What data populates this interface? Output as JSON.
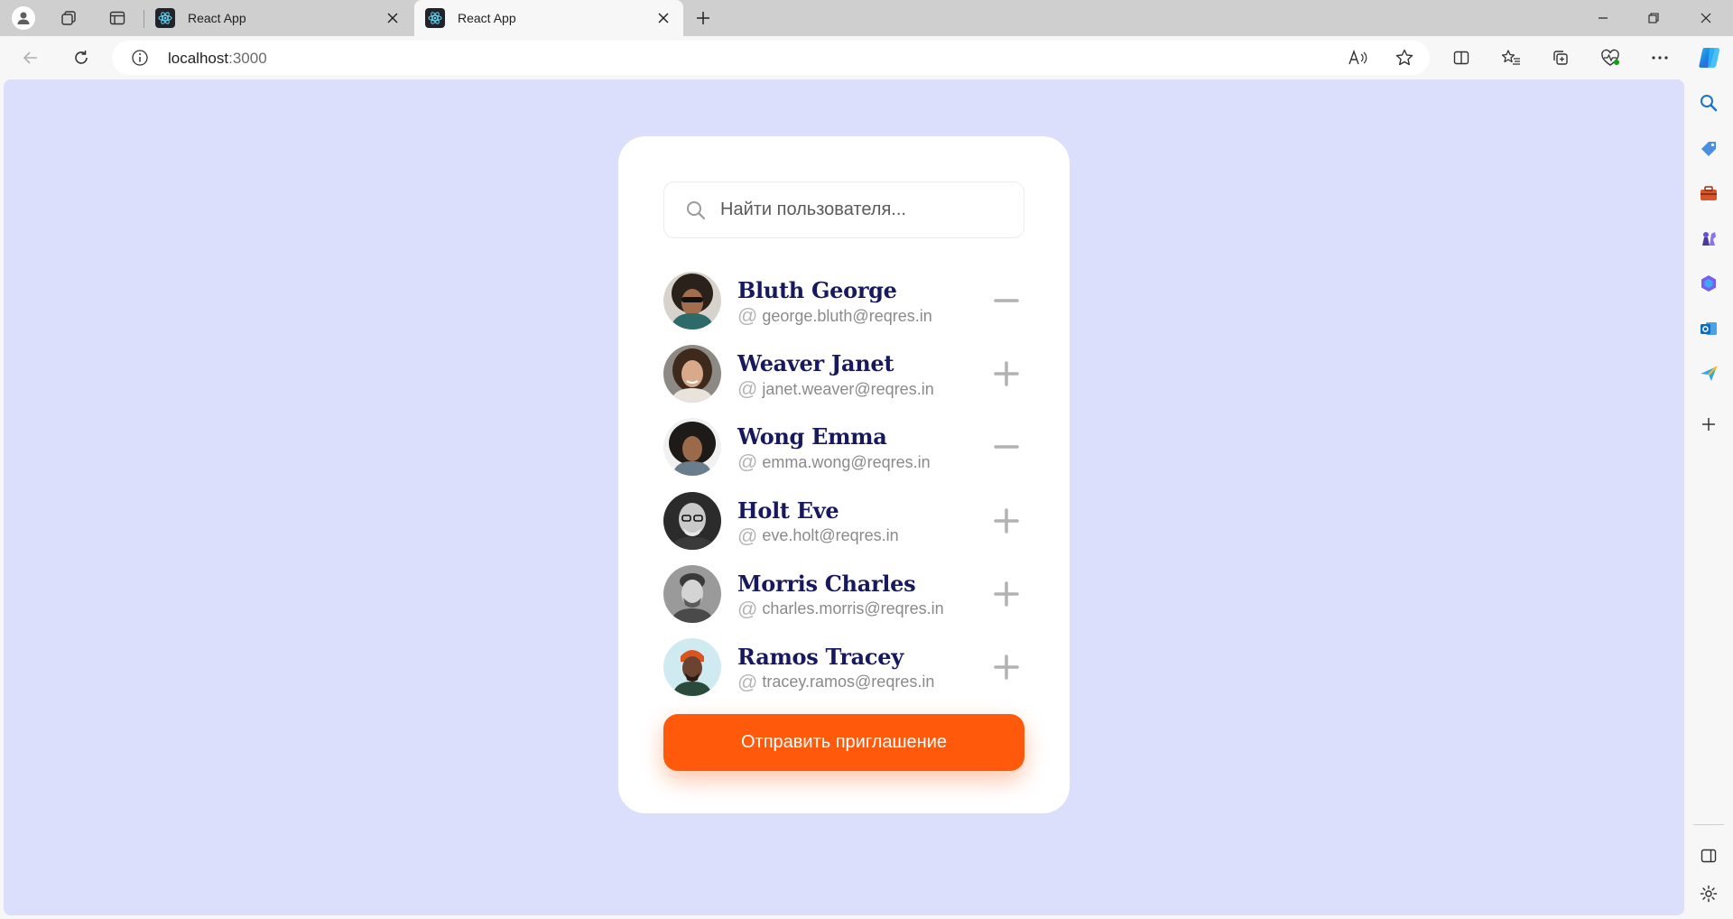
{
  "browser": {
    "tabs": [
      {
        "title": "React App",
        "active": false
      },
      {
        "title": "React App",
        "active": true
      }
    ],
    "url_host": "localhost",
    "url_port": ":3000"
  },
  "app": {
    "search": {
      "placeholder": "Найти пользователя..."
    },
    "users": [
      {
        "name": "Bluth George",
        "email": "george.bluth@reqres.in",
        "action": "minus-icon"
      },
      {
        "name": "Weaver Janet",
        "email": "janet.weaver@reqres.in",
        "action": "plus-icon"
      },
      {
        "name": "Wong Emma",
        "email": "emma.wong@reqres.in",
        "action": "minus-icon"
      },
      {
        "name": "Holt Eve",
        "email": "eve.holt@reqres.in",
        "action": "plus-icon"
      },
      {
        "name": "Morris Charles",
        "email": "charles.morris@reqres.in",
        "action": "plus-icon"
      },
      {
        "name": "Ramos Tracey",
        "email": "tracey.ramos@reqres.in",
        "action": "plus-icon"
      }
    ],
    "at_symbol": "@",
    "invite_button": "Отправить приглашение"
  },
  "colors": {
    "page_background": "#dcdffc",
    "name_text": "#18185e",
    "accent": "#ff5a0b"
  }
}
